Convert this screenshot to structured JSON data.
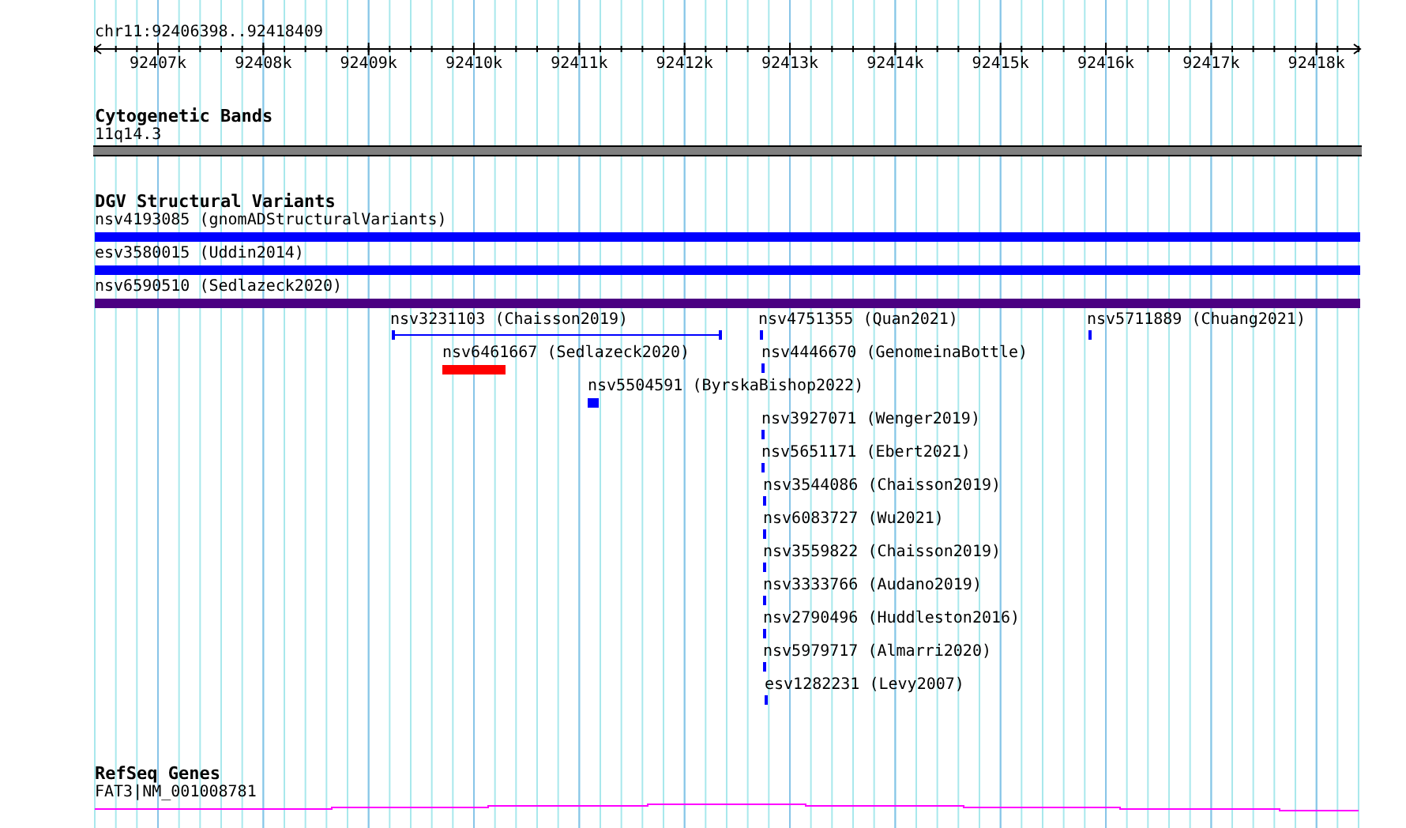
{
  "region": {
    "title": "chr11:92406398..92418409",
    "ticks": [
      "92407k",
      "92408k",
      "92409k",
      "92410k",
      "92411k",
      "92412k",
      "92413k",
      "92414k",
      "92415k",
      "92416k",
      "92417k",
      "92418k"
    ]
  },
  "tracks": [
    {
      "title": "Cytogenetic Bands",
      "features": [
        {
          "label": "11q14.3",
          "kind": "band"
        }
      ]
    },
    {
      "title": "DGV Structural Variants",
      "features": [
        {
          "label": "nsv4193085 (gnomADStructuralVariants)",
          "kind": "full",
          "color": "#0000ff"
        },
        {
          "label": "esv3580015 (Uddin2014)",
          "kind": "full",
          "color": "#0000ff"
        },
        {
          "label": "nsv6590510 (Sedlazeck2020)",
          "kind": "full",
          "color": "#4b0082"
        },
        {
          "label": "nsv3231103 (Chaisson2019)",
          "kind": "span",
          "color": "#0000ff"
        },
        {
          "label": "nsv4751355 (Quan2021)",
          "kind": "tick",
          "color": "#0000ff"
        },
        {
          "label": "nsv5711889 (Chuang2021)",
          "kind": "tick",
          "color": "#0000ff"
        },
        {
          "label": "nsv6461667 (Sedlazeck2020)",
          "kind": "block",
          "color": "#ff0000"
        },
        {
          "label": "nsv4446670 (GenomeinaBottle)",
          "kind": "tick",
          "color": "#0000ff"
        },
        {
          "label": "nsv5504591 (ByrskaBishop2022)",
          "kind": "block",
          "color": "#0000ff"
        },
        {
          "label": "nsv3927071 (Wenger2019)",
          "kind": "tick",
          "color": "#0000ff"
        },
        {
          "label": "nsv5651171 (Ebert2021)",
          "kind": "tick",
          "color": "#0000ff"
        },
        {
          "label": "nsv3544086 (Chaisson2019)",
          "kind": "tick",
          "color": "#0000ff"
        },
        {
          "label": "nsv6083727 (Wu2021)",
          "kind": "tick",
          "color": "#0000ff"
        },
        {
          "label": "nsv3559822 (Chaisson2019)",
          "kind": "tick",
          "color": "#0000ff"
        },
        {
          "label": "nsv3333766 (Audano2019)",
          "kind": "tick",
          "color": "#0000ff"
        },
        {
          "label": "nsv2790496 (Huddleston2016)",
          "kind": "tick",
          "color": "#0000ff"
        },
        {
          "label": "nsv5979717 (Almarri2020)",
          "kind": "tick",
          "color": "#0000ff"
        },
        {
          "label": "esv1282231 (Levy2007)",
          "kind": "tick",
          "color": "#0000ff"
        }
      ]
    },
    {
      "title": "RefSeq Genes",
      "features": [
        {
          "label": "FAT3|NM_001008781",
          "kind": "gene"
        }
      ]
    }
  ]
}
